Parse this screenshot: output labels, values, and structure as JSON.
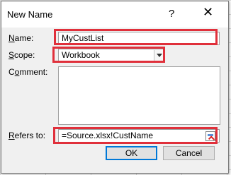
{
  "dialog": {
    "title": "New Name",
    "help_glyph": "?",
    "close_glyph": "✕"
  },
  "form": {
    "name_label_key": "N",
    "name_label_rest": "ame:",
    "name_value": "MyCustList",
    "scope_label_key": "S",
    "scope_label_rest": "cope:",
    "scope_value": "Workbook",
    "comment_label_pre": "C",
    "comment_label_key": "o",
    "comment_label_rest": "mment:",
    "comment_value": "",
    "refers_label_key": "R",
    "refers_label_rest": "efers to:",
    "refers_value": "=Source.xlsx!CustName"
  },
  "buttons": {
    "ok": "OK",
    "cancel": "Cancel"
  },
  "colors": {
    "highlight": "#e0303b",
    "ok_border": "#0078d7"
  }
}
